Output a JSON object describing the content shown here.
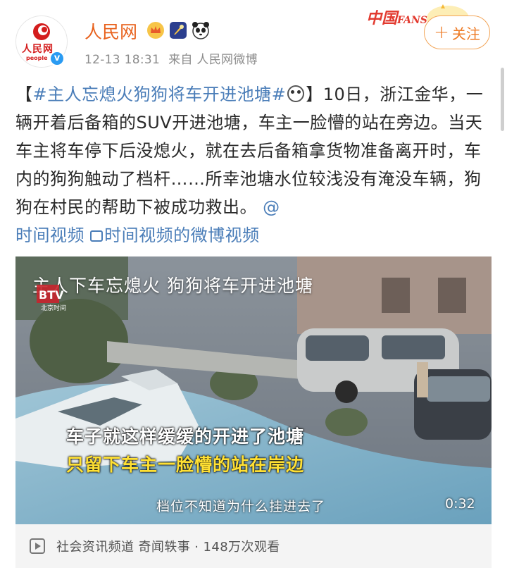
{
  "author": {
    "name": "人民网",
    "avatar_text": "人民网",
    "avatar_sub": "people",
    "verified_mark": "v",
    "timestamp": "12-13 18:31",
    "source": "来自 人民网微博"
  },
  "follow": {
    "plus": "+",
    "label": "关注"
  },
  "fans_banner": {
    "text": "中国",
    "suffix": "FANS"
  },
  "post": {
    "hashtag": "#主人忘熄火狗狗将车开进池塘#",
    "bracket_open": "【",
    "bracket_close": "】",
    "body": "10日，浙江金华，一辆开着后备箱的SUV开进池塘，车主一脸懵的站在旁边。当天车主将车停下后没熄火，就在去后备箱拿货物准备离开时，车内的狗狗触动了档杆……所幸池塘水位较浅没有淹没车辆，狗狗在村民的帮助下被成功救出。",
    "mention_at": "@",
    "mention": "时间视频",
    "video_link": "时间视频的微博视频"
  },
  "video": {
    "title": "主人下车忘熄火 狗狗将车开进池塘",
    "logo_text": "北京时间",
    "subtitle_1": "车子就这样缓缓的开进了池塘",
    "subtitle_2": "只留下车主一脸懵的站在岸边",
    "subtitle_3": "档位不知道为什么挂进去了",
    "duration": "0:32"
  },
  "footer": {
    "text": "社会资讯频道 奇闻轶事 · 148万次观看"
  },
  "colors": {
    "brand_orange": "#e8611c",
    "link_blue": "#4a7db8",
    "follow_orange": "#ee7b25",
    "subtitle_yellow": "#ffe033"
  }
}
